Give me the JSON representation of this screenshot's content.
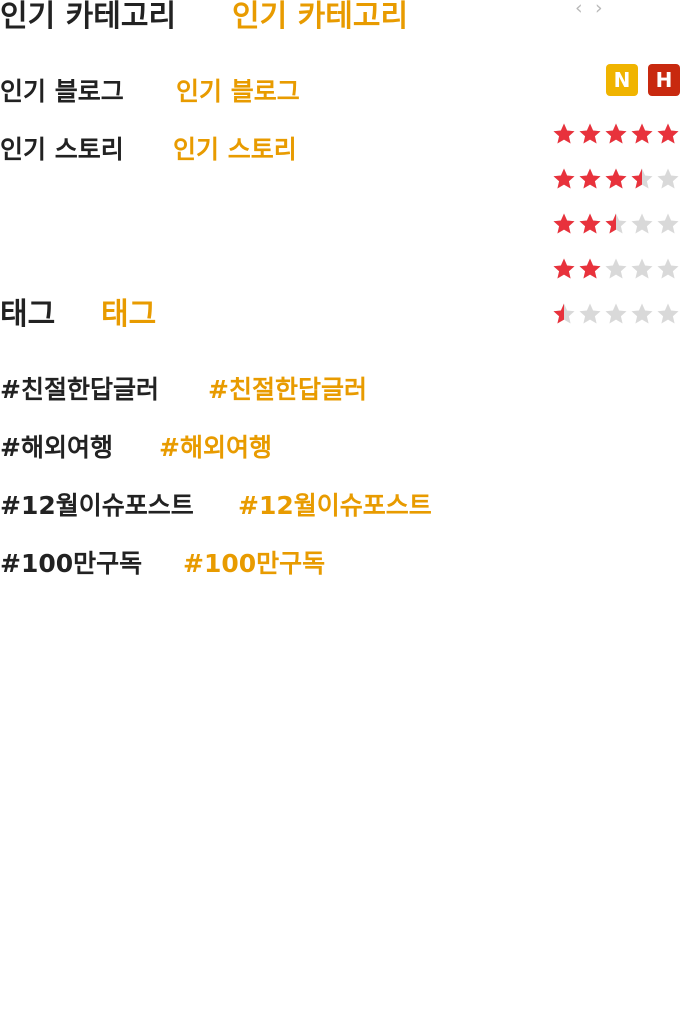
{
  "sections": {
    "popular_category": {
      "label": "인기 카테고리",
      "label_highlight": "인기 카테고리"
    },
    "popular_blog": {
      "label": "인기 블로그",
      "label_highlight": "인기 블로그"
    },
    "popular_story": {
      "label": "인기 스토리",
      "label_highlight": "인기 스토리"
    },
    "tag": {
      "label": "태그",
      "label_highlight": "태그"
    }
  },
  "tags": [
    {
      "label": "#친절한답글러",
      "label_highlight": "#친절한답글러"
    },
    {
      "label": "#해외여행",
      "label_highlight": "#해외여행"
    },
    {
      "label": "#12월이슈포스트",
      "label_highlight": "#12월이슈포스트"
    },
    {
      "label": "#100만구독",
      "label_highlight": "#100만구독"
    }
  ],
  "nav": {
    "prev_icon": "chevron-left-icon",
    "next_icon": "chevron-right-icon"
  },
  "badges": [
    {
      "text": "N",
      "color": "#f0b400"
    },
    {
      "text": "H",
      "color": "#c8290f"
    }
  ],
  "ratings": [
    5,
    3.5,
    2.5,
    2,
    0.5
  ],
  "colors": {
    "text": "#222222",
    "highlight": "#e89b00",
    "star_filled": "#e8323c",
    "star_empty": "#d9d9d9",
    "arrow": "#b8b8b8"
  }
}
